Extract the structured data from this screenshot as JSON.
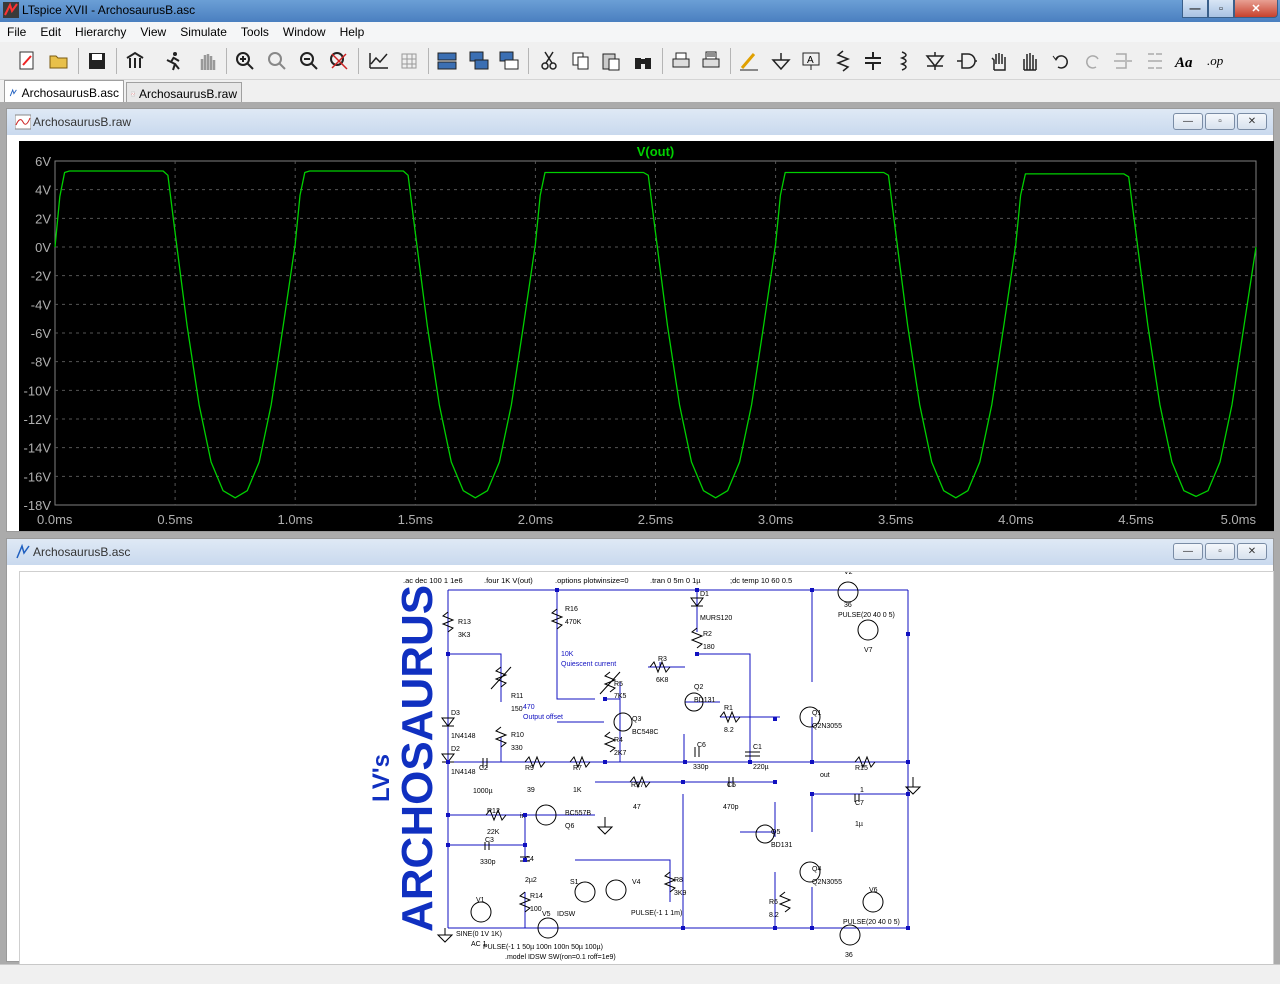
{
  "window": {
    "title": "LTspice XVII - ArchosaurusB.asc",
    "minimize": "—",
    "maximize": "▫",
    "close": "✕"
  },
  "menu": [
    "File",
    "Edit",
    "Hierarchy",
    "View",
    "Simulate",
    "Tools",
    "Window",
    "Help"
  ],
  "toolbar": {
    "icons": [
      "new-schematic-icon",
      "open-icon",
      "save-icon",
      "control-panel-icon",
      "run-icon",
      "halt-icon",
      "zoom-in-icon",
      "zoom-pan-icon",
      "zoom-out-icon",
      "zoom-fit-icon",
      "autorange-icon",
      "grid-icon",
      "tile-horizontal-icon",
      "cascade-icon",
      "close-all-icon",
      "cut-icon",
      "copy-icon",
      "paste-icon",
      "find-icon",
      "print-icon",
      "print-preview-icon",
      "draw-wire-icon",
      "ground-icon",
      "label-net-icon",
      "resistor-icon",
      "capacitor-icon",
      "inductor-icon",
      "diode-icon",
      "component-icon",
      "move-icon",
      "drag-icon",
      "undo-icon",
      "redo-icon",
      "rotate-icon",
      "mirror-icon",
      "text-icon",
      "spice-directive-icon"
    ]
  },
  "tabs": [
    {
      "label": "ArchosaurusB.asc",
      "active": true
    },
    {
      "label": "ArchosaurusB.raw",
      "active": false
    }
  ],
  "plot_window": {
    "title": "ArchosaurusB.raw",
    "trace_label": "V(out)",
    "trace_color": "#00d000",
    "background": "#000000"
  },
  "schematic_window": {
    "title": "ArchosaurusB.asc",
    "directives": [
      ".ac dec 100 1 1e6",
      ".four 1K V(out)",
      ".options plotwinsize=0",
      ".tran 0 5m 0 1µ",
      ";dc temp 10 60 0.5"
    ],
    "side_title_small": "LV's",
    "side_title_big": "ARCHOSAURUS",
    "labels": {
      "r13": "R13",
      "r13v": "3K3",
      "r16": "R16",
      "r16v": "470K",
      "d1": "D1",
      "d1v": "MURS120",
      "r2": "R2",
      "r2v": "180",
      "v2": "V2",
      "v2v": "36",
      "v2p": "PULSE(20 40 0 5)",
      "v7": "V7",
      "ann1": "10K",
      "ann2": "Quiescent current",
      "r3": "R3",
      "r3v": "6K8",
      "r5": "R5",
      "r5v": "7K5",
      "q2": "Q2",
      "q2v": "BD131",
      "r11": "R11",
      "r11v": "150",
      "ann3": "470",
      "ann4": "Output offset",
      "r10": "R10",
      "r10v": "330",
      "d3": "D3",
      "d3v": "1N4148",
      "d2": "D2",
      "d2v": "1N4148",
      "q3": "Q3",
      "q3v": "BC548C",
      "r1": "R1",
      "r1v": "8.2",
      "q1": "Q1",
      "q1v": "Q2N3055",
      "r4": "R4",
      "r4v": "2K7",
      "c6": "C6",
      "c6v": "330p",
      "c1": "C1",
      "c1v": "220µ",
      "c2": "C2",
      "c2v": "1000µ",
      "r9": "R9",
      "r9v": "39",
      "r7": "R7",
      "r7v": "1K",
      "out": "out",
      "r15": "R15",
      "r15v": "1",
      "r17": "R17",
      "r17v": "47",
      "c5": "C5",
      "c5v": "470p",
      "c7": "C7",
      "c7v": "1µ",
      "r12": "R12",
      "r12v": "22K",
      "in": "in",
      "q6": "Q6",
      "q6v": "BC557B",
      "c3": "C3",
      "c3v": "330p",
      "q5": "Q5",
      "q5v": "BD131",
      "c4": "C4",
      "c4v": "2µ2",
      "q4": "Q4",
      "q4v": "Q2N3055",
      "s1": "S1",
      "v4": "V4",
      "v4p": "PULSE(-1 1 1m)",
      "r8": "R8",
      "r8v": "3K9",
      "r14": "R14",
      "r14v": "100",
      "v6": "V6",
      "v6p": "PULSE(20 40 0 5)",
      "v1": "V1",
      "v1p": "SINE(0 1V 1K)",
      "v1ac": "AC 1",
      "v5": "V5",
      "v5p": "PULSE(-1 1 50µ 100n 100n 50µ 100µ)",
      "idsw": "IDSW",
      "r6": "R6",
      "r6v": "8.2",
      "v3v": "36",
      "model": ".model IDSW SW(ron=0.1 roff=1e9)"
    }
  },
  "chart_data": {
    "type": "line",
    "title": "V(out)",
    "xlabel": "",
    "ylabel": "",
    "xlim": [
      0,
      5
    ],
    "ylim": [
      -18,
      6
    ],
    "x_unit": "ms",
    "y_unit": "V",
    "x_ticks": [
      "0.0ms",
      "0.5ms",
      "1.0ms",
      "1.5ms",
      "2.0ms",
      "2.5ms",
      "3.0ms",
      "3.5ms",
      "4.0ms",
      "4.5ms",
      "5.0ms"
    ],
    "y_ticks": [
      "6V",
      "4V",
      "2V",
      "0V",
      "-2V",
      "-4V",
      "-6V",
      "-8V",
      "-10V",
      "-12V",
      "-14V",
      "-16V",
      "-18V"
    ],
    "grid": true,
    "series": [
      {
        "name": "V(out)",
        "color": "#00d000",
        "x": [
          0.0,
          0.02,
          0.04,
          0.06,
          0.45,
          0.47,
          0.5,
          0.55,
          0.6,
          0.65,
          0.7,
          0.75,
          0.8,
          0.85,
          0.9,
          0.95,
          1.0,
          1.02,
          1.04,
          1.06,
          1.45,
          1.47,
          1.5,
          1.55,
          1.6,
          1.65,
          1.7,
          1.75,
          1.8,
          1.85,
          1.9,
          1.95,
          2.0,
          2.02,
          2.04,
          2.06,
          2.45,
          2.47,
          2.5,
          2.55,
          2.6,
          2.65,
          2.7,
          2.75,
          2.8,
          2.85,
          2.9,
          2.95,
          3.0,
          3.02,
          3.04,
          3.06,
          3.45,
          3.47,
          3.5,
          3.55,
          3.6,
          3.65,
          3.7,
          3.75,
          3.8,
          3.85,
          3.9,
          3.95,
          4.0,
          4.02,
          4.04,
          4.06,
          4.45,
          4.47,
          4.5,
          4.55,
          4.6,
          4.65,
          4.7,
          4.75,
          4.8,
          4.85,
          4.9,
          4.95,
          5.0
        ],
        "y": [
          0.0,
          3.5,
          5.2,
          5.3,
          5.3,
          5.0,
          1.0,
          -5.5,
          -11.0,
          -15.0,
          -17.0,
          -17.5,
          -17.0,
          -15.0,
          -11.0,
          -5.5,
          0.2,
          3.6,
          5.2,
          5.3,
          5.3,
          5.0,
          1.0,
          -5.5,
          -11.0,
          -15.0,
          -17.0,
          -17.5,
          -17.0,
          -15.0,
          -11.0,
          -5.5,
          0.2,
          3.6,
          5.2,
          5.2,
          5.2,
          5.0,
          1.0,
          -5.5,
          -11.0,
          -15.0,
          -17.0,
          -17.5,
          -17.0,
          -15.0,
          -11.0,
          -5.5,
          0.2,
          3.6,
          5.2,
          5.2,
          5.2,
          5.0,
          1.0,
          -5.5,
          -11.0,
          -15.0,
          -17.0,
          -17.5,
          -17.0,
          -15.0,
          -11.0,
          -5.5,
          0.2,
          3.6,
          5.1,
          5.1,
          5.1,
          4.9,
          1.0,
          -5.5,
          -11.0,
          -15.0,
          -17.0,
          -17.4,
          -17.0,
          -15.0,
          -11.0,
          -5.5,
          0.0
        ]
      }
    ]
  }
}
